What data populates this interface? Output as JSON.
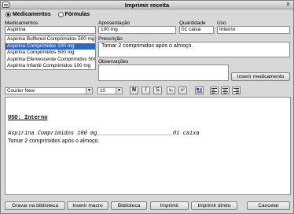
{
  "window": {
    "title": "Imprimir receita",
    "close_glyph": "x"
  },
  "mode": {
    "options": [
      "Medicamentos",
      "Fórmulas"
    ],
    "selected": "Medicamentos"
  },
  "labels": {
    "medicamentos": "Medicamentos",
    "apresentacao": "Apresentação",
    "quantidade": "Quantidade",
    "uso": "Uso",
    "prescricao": "Prescrição",
    "observacoes": "Observações"
  },
  "fields": {
    "medicamento": "Aspirina",
    "apresentacao": "100 mg",
    "quantidade": "01 caixa",
    "uso": "Interno",
    "prescricao": "Tomar 2 comprimidos após o almoço.",
    "observacoes": ""
  },
  "medication_list": {
    "items": [
      "Aspirina Buffered Comprimidos 500 mg",
      "Aspirina Comprimidos 100 mg",
      "Aspirina Comprimidos 500 mg",
      "Aspirina Efervescente Comprimidos 500",
      "Aspirina Infantil Comprimidos 100 mg"
    ],
    "selected_index": 1
  },
  "buttons": {
    "inserir_medicamento": "Inserir medicamento",
    "gravar_biblioteca": "Gravar na biblioteca",
    "inserir_macro": "Inserir macro",
    "biblioteca": "Biblioteca",
    "imprimir": "Imprimir",
    "imprimir_direto": "Imprimir direto",
    "cancelar": "Cancelar"
  },
  "toolbar": {
    "font": "Courier New",
    "size": "10",
    "bold": "N",
    "italic": "I",
    "strike": "S",
    "subscript": "x₂",
    "superscript": "x²"
  },
  "editor": {
    "line1": "USO: Interno",
    "line2": "Aspirina Comprimidos 100 mg_______________________01 caixa",
    "line3": "Tomar 2 comprimidos após o almoço."
  }
}
